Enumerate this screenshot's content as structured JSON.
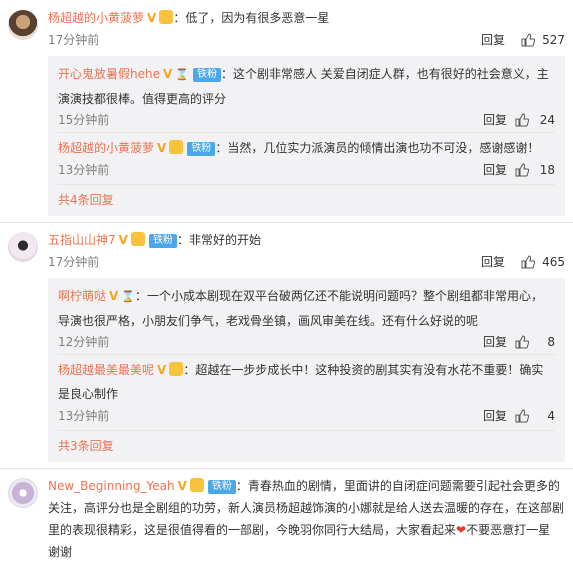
{
  "comments": [
    {
      "username": "杨超越的小黄菠萝",
      "vip": "V",
      "text": "：低了，因为有很多恶意一星",
      "time": "17分钟前",
      "reply_label": "回复",
      "likes": "527",
      "replies": [
        {
          "username": "开心鬼放暑假hehe",
          "vip": "V",
          "hourglass": "⌛",
          "fan_badge": "铁粉",
          "text_line1": "：这个剧非常感人 关爱自闭症人群，也有很好的社会意义，主",
          "text_line2": "演演技都很棒。值得更高的评分",
          "time": "15分钟前",
          "reply_label": "回复",
          "likes": "24"
        },
        {
          "username": "杨超越的小黄菠萝",
          "vip": "V",
          "fan_badge": "铁粉",
          "text_line1": "：当然，几位实力派演员的倾情出演也功不可没，感谢感谢！",
          "time": "13分钟前",
          "reply_label": "回复",
          "likes": "18"
        }
      ],
      "more_replies": "共4条回复"
    },
    {
      "username": "五指山山神7",
      "vip": "V",
      "fan_badge": "铁粉",
      "text": "：非常好的开始",
      "time": "17分钟前",
      "reply_label": "回复",
      "likes": "465",
      "replies": [
        {
          "username": "啊柠萌哒",
          "vip": "V",
          "hourglass": "⌛",
          "text_line1": "：一个小成本剧现在双平台破两亿还不能说明问题吗？整个剧组都非常用心，",
          "text_line2": "导演也很严格，小朋友们争气，老戏骨坐镇，画风审美在线。还有什么好说的呢",
          "time": "12分钟前",
          "reply_label": "回复",
          "likes": "8"
        },
        {
          "username": "杨超越最美最美呢",
          "vip": "V",
          "text_line1": "：超越在一步步成长中！这种投资的剧其实有没有水花不重要！确实",
          "text_line2": "是良心制作",
          "time": "13分钟前",
          "reply_label": "回复",
          "likes": "4"
        }
      ],
      "more_replies": "共3条回复"
    },
    {
      "username": "New_Beginning_Yeah",
      "vip": "V",
      "fan_badge": "铁粉",
      "text_line1": "：青春热血的剧情，里面讲的自闭症问题需要引起社会更多的",
      "text_line2": "关注，高评分也是全剧组的功劳，新人演员杨超越饰演的小娜就是给人送去温暖的存在，在这部剧",
      "text_line3": "里的表现很精彩，这是很值得看的一部剧，今晚羽你同行大结局，大家看起来",
      "heart": "❤",
      "text_line3b": "不要恶意打一星",
      "text_line4": "谢谢"
    }
  ]
}
